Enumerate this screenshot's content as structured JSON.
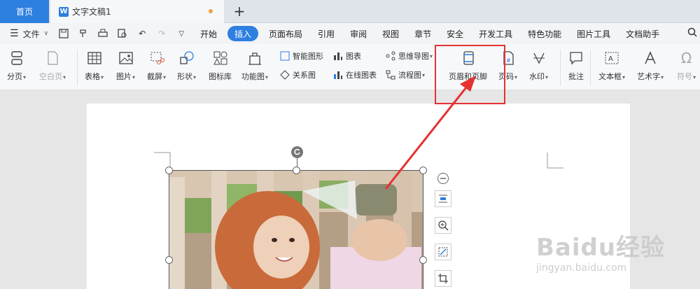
{
  "titlebar": {
    "home_tab": "首页",
    "doc_tab": "文字文稿1",
    "doc_icon_letter": "W",
    "add_tab": "+"
  },
  "menubar": {
    "menu_icon": "hamburger-icon",
    "file_label": "文件",
    "tabs": [
      "开始",
      "插入",
      "页面布局",
      "引用",
      "审阅",
      "视图",
      "章节",
      "安全",
      "开发工具",
      "特色功能",
      "图片工具",
      "文档助手"
    ],
    "active_tab": "插入"
  },
  "ribbon": {
    "page_break": "分页",
    "blank_page": "空白页",
    "table": "表格",
    "picture": "图片",
    "screenshot": "截屏",
    "shape": "形状",
    "icon_lib": "图标库",
    "func_chart": "功能图",
    "smart_shape": "智能图形",
    "relation": "关系图",
    "chart": "图表",
    "online_chart": "在线图表",
    "mindmap": "思维导图",
    "flowchart": "流程图",
    "header_footer": "页眉和页脚",
    "page_number": "页码",
    "watermark": "水印",
    "comment": "批注",
    "textbox": "文本框",
    "art_text": "艺术字",
    "symbol": "符号"
  },
  "watermark": {
    "brand": "Baidu经验",
    "url": "jingyan.baidu.com"
  },
  "colors": {
    "accent": "#2d7fe0",
    "highlight": "#e63232",
    "unsaved_dot": "#f0a040"
  }
}
